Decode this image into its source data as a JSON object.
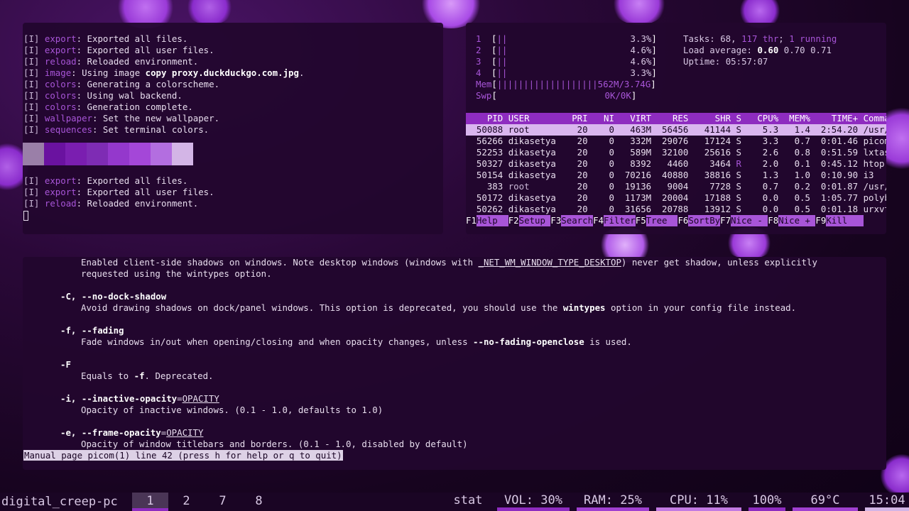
{
  "wal_log": {
    "lines": [
      {
        "tag": "[I]",
        "module": "export",
        "text": ": Exported all files."
      },
      {
        "tag": "[I]",
        "module": "export",
        "text": ": Exported all user files."
      },
      {
        "tag": "[I]",
        "module": "reload",
        "text": ": Reloaded environment."
      },
      {
        "tag": "[I]",
        "module": "image",
        "text": ": Using image ",
        "bold": "copy proxy.duckduckgo.com.jpg",
        "after": "."
      },
      {
        "tag": "[I]",
        "module": "colors",
        "text": ": Generating a colorscheme."
      },
      {
        "tag": "[I]",
        "module": "colors",
        "text": ": Using wal backend."
      },
      {
        "tag": "[I]",
        "module": "colors",
        "text": ": Generation complete."
      },
      {
        "tag": "[I]",
        "module": "wallpaper",
        "text": ": Set the new wallpaper."
      },
      {
        "tag": "[I]",
        "module": "sequences",
        "text": ": Set terminal colors."
      }
    ],
    "swatches": [
      "#9a7fa8",
      "#6a12a0",
      "#7a1eb0",
      "#7e2cb4",
      "#9438cc",
      "#a447d8",
      "#b36ee0",
      "#d3b5e6"
    ],
    "lines2": [
      {
        "tag": "[I]",
        "module": "export",
        "text": ": Exported all files."
      },
      {
        "tag": "[I]",
        "module": "export",
        "text": ": Exported all user files."
      },
      {
        "tag": "[I]",
        "module": "reload",
        "text": ": Reloaded environment."
      }
    ]
  },
  "htop": {
    "cpus": [
      {
        "n": "1",
        "pct": "3.3%"
      },
      {
        "n": "2",
        "pct": "4.6%"
      },
      {
        "n": "3",
        "pct": "4.6%"
      },
      {
        "n": "4",
        "pct": "3.3%"
      }
    ],
    "mem_label": "Mem",
    "mem_value": "562M/3.74G",
    "swp_label": "Swp",
    "swp_value": "0K/0K",
    "tasks_label": "Tasks: ",
    "tasks": "68",
    "thr": "117 thr",
    "running": "1 running",
    "load_label": "Load average: ",
    "load1": "0.60",
    "load5": "0.70",
    "load15": "0.71",
    "uptime_label": "Uptime: ",
    "uptime": "05:57:07",
    "header": [
      "PID",
      "USER",
      "PRI",
      "NI",
      "VIRT",
      "RES",
      "SHR",
      "S",
      "CPU%",
      "MEM%",
      "TIME+",
      "Command"
    ],
    "rows": [
      [
        "50088",
        "root",
        "20",
        "0",
        "463M",
        "56456",
        "41144",
        "S",
        "5.3",
        "1.4",
        "2:54.20",
        "/usr/lib/Xorg"
      ],
      [
        "56266",
        "dikasetya",
        "20",
        "0",
        "332M",
        "29076",
        "17124",
        "S",
        "3.3",
        "0.7",
        "0:01.46",
        "picom --vsync"
      ],
      [
        "52253",
        "dikasetya",
        "20",
        "0",
        "589M",
        "32100",
        "25616",
        "S",
        "2.6",
        "0.8",
        "0:51.59",
        "lxtask"
      ],
      [
        "50327",
        "dikasetya",
        "20",
        "0",
        "8392",
        "4460",
        "3464",
        "R",
        "2.0",
        "0.1",
        "0:45.12",
        "htop"
      ],
      [
        "50154",
        "dikasetya",
        "20",
        "0",
        "70216",
        "40880",
        "38816",
        "S",
        "1.3",
        "1.0",
        "0:10.90",
        "i3"
      ],
      [
        "383",
        "root",
        "20",
        "0",
        "19136",
        "9004",
        "7728",
        "S",
        "0.7",
        "0.2",
        "0:01.87",
        "/usr/lib/syste"
      ],
      [
        "50172",
        "dikasetya",
        "20",
        "0",
        "1173M",
        "20004",
        "17188",
        "S",
        "0.0",
        "0.5",
        "1:05.77",
        "polybar -r exa"
      ],
      [
        "50262",
        "dikasetya",
        "20",
        "0",
        "31656",
        "20788",
        "13912",
        "S",
        "0.0",
        "0.5",
        "0:01.18",
        "urxvt"
      ]
    ],
    "fkeys": [
      {
        "k": "F1",
        "l": "Help  "
      },
      {
        "k": "F2",
        "l": "Setup "
      },
      {
        "k": "F3",
        "l": "Search"
      },
      {
        "k": "F4",
        "l": "Filter"
      },
      {
        "k": "F5",
        "l": "Tree  "
      },
      {
        "k": "F6",
        "l": "SortBy"
      },
      {
        "k": "F7",
        "l": "Nice - "
      },
      {
        "k": "F8",
        "l": "Nice + "
      },
      {
        "k": "F9",
        "l": "Kill   "
      }
    ]
  },
  "man": {
    "l1a": "Enabled client-side shadows on windows. Note desktop windows (windows with ",
    "l1u": "_NET_WM_WINDOW_TYPE_DESKTOP",
    "l1b": ") never get shadow, unless explicitly",
    "l2": "requested using the wintypes option.",
    "o1": "-C, --no-dock-shadow",
    "o1d_a": "Avoid drawing shadows on dock/panel windows. This option is deprecated, you should use the ",
    "o1d_b": "wintypes",
    "o1d_c": " option in your config file instead.",
    "o2": "-f, --fading",
    "o2d_a": "Fade windows in/out when opening/closing and when opacity changes, unless ",
    "o2d_b": "--no-fading-openclose",
    "o2d_c": " is used.",
    "o3": "-F",
    "o3d_a": "Equals to ",
    "o3d_b": "-f",
    "o3d_c": ". Deprecated.",
    "o4a": "-i, --inactive-opacity",
    "o4b": "=",
    "o4c": "OPACITY",
    "o4d": "Opacity of inactive windows. (0.1 - 1.0, defaults to 1.0)",
    "o5a": "-e, --frame-opacity",
    "o5b": "=",
    "o5c": "OPACITY",
    "o5d": "Opacity of window titlebars and borders. (0.1 - 1.0, disabled by default)",
    "status": "Manual page picom(1) line 42 (press h for help or q to quit)"
  },
  "bar": {
    "hostname": "digital_creep-pc",
    "workspaces": [
      "1",
      "2",
      "7",
      "8"
    ],
    "active_workspace": "1",
    "modules": [
      {
        "label": "stat",
        "color": ""
      },
      {
        "label": "VOL: 30%",
        "color": "#8e2cc0"
      },
      {
        "label": "RAM: 25%",
        "color": "#a040d0"
      },
      {
        "label": "CPU: 11%",
        "color": "#c27ae2"
      },
      {
        "label": "100%",
        "color": "#8e2cc0"
      },
      {
        "label": "69°C",
        "color": "#a040d0"
      },
      {
        "label": "15:04",
        "color": "#d3b5e6"
      }
    ]
  }
}
